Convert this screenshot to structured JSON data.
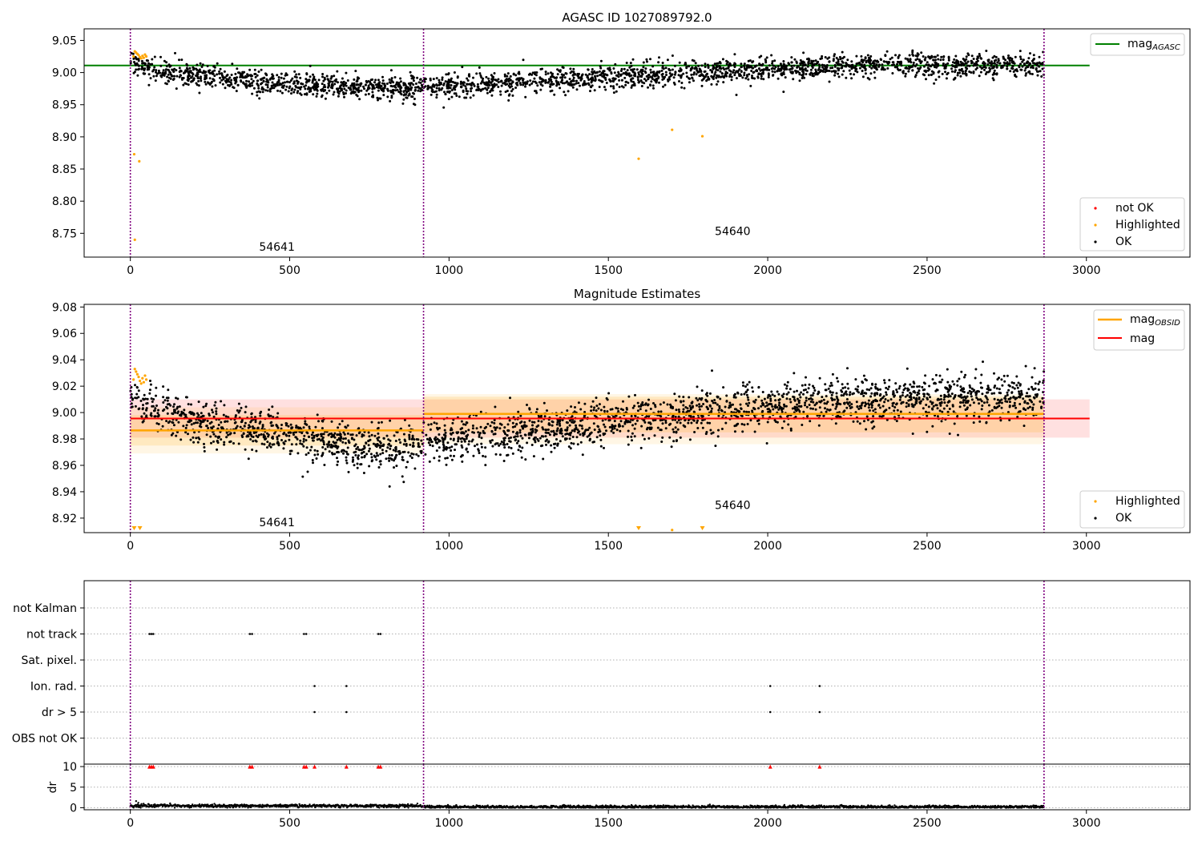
{
  "chart_data": [
    {
      "id": "agasc",
      "type": "scatter",
      "title": "AGASC ID 1027089792.0",
      "xlim": [
        -145,
        3325
      ],
      "ylim": [
        8.713,
        9.068
      ],
      "x_ticks": [
        0,
        500,
        1000,
        1500,
        2000,
        2500,
        3000
      ],
      "x_tick_labels": [
        "0",
        "500",
        "1000",
        "1500",
        "2000",
        "2500",
        "3000"
      ],
      "y_ticks": [
        8.75,
        8.8,
        8.85,
        8.9,
        8.95,
        9.0,
        9.05
      ],
      "y_tick_labels": [
        "8.75",
        "8.80",
        "8.85",
        "8.90",
        "8.95",
        "9.00",
        "9.05"
      ],
      "obsid_boundaries": [
        0,
        920,
        2867
      ],
      "obsid_labels": [
        {
          "text": "54641",
          "x": 460,
          "y": 8.723
        },
        {
          "text": "54640",
          "x": 1890,
          "y": 8.747
        }
      ],
      "mag_agasc": {
        "value": 9.011,
        "x_range": [
          -145,
          3010
        ],
        "color": "#008000"
      },
      "trend": {
        "x": [
          0,
          60,
          200,
          500,
          700,
          850,
          920,
          1200,
          1600,
          1900,
          2200,
          2500,
          2700,
          2867
        ],
        "y": [
          9.015,
          9.005,
          8.995,
          8.983,
          8.978,
          8.975,
          8.979,
          8.985,
          8.995,
          9.003,
          9.01,
          9.012,
          9.012,
          9.013
        ]
      },
      "noise": 0.009,
      "n_ok_points": 2600,
      "highlighted_points": {
        "x": [
          10,
          14,
          18,
          22,
          26,
          30,
          34,
          38,
          42,
          46,
          50,
          12,
          28,
          14,
          1595,
          1700,
          1795
        ],
        "y": [
          9.025,
          9.033,
          9.031,
          9.029,
          9.027,
          9.024,
          9.022,
          9.026,
          9.023,
          9.028,
          9.025,
          8.873,
          8.862,
          8.74,
          8.866,
          8.911,
          8.901
        ]
      },
      "legend_top": {
        "entries": [
          {
            "label": "mag",
            "subscript": "AGASC",
            "color": "#008000"
          }
        ],
        "placement": "top-right"
      },
      "legend_bottom": {
        "entries": [
          {
            "label": "not OK",
            "color": "#ff0000"
          },
          {
            "label": "Highlighted",
            "color": "#ffa500"
          },
          {
            "label": "OK",
            "color": "#000000"
          }
        ],
        "placement": "bottom-right"
      }
    },
    {
      "id": "estimates",
      "type": "scatter",
      "title": "Magnitude Estimates",
      "xlim": [
        -145,
        3325
      ],
      "ylim": [
        8.909,
        9.082
      ],
      "x_ticks": [
        0,
        500,
        1000,
        1500,
        2000,
        2500,
        3000
      ],
      "x_tick_labels": [
        "0",
        "500",
        "1000",
        "1500",
        "2000",
        "2500",
        "3000"
      ],
      "y_ticks": [
        8.92,
        8.94,
        8.96,
        8.98,
        9.0,
        9.02,
        9.04,
        9.06,
        9.08
      ],
      "y_tick_labels": [
        "8.92",
        "8.94",
        "8.96",
        "8.98",
        "9.00",
        "9.02",
        "9.04",
        "9.06",
        "9.08"
      ],
      "obsid_boundaries": [
        0,
        920,
        2867
      ],
      "obsid_labels": [
        {
          "text": "54641",
          "x": 460,
          "y": 8.914
        },
        {
          "text": "54640",
          "x": 1890,
          "y": 8.927
        }
      ],
      "mag": {
        "value": 8.9955,
        "band": [
          8.981,
          9.01
        ],
        "x_range": [
          0,
          3010
        ],
        "color": "#ff0000"
      },
      "mag_obsid": [
        {
          "x_range": [
            0,
            920
          ],
          "value": 8.9865,
          "band": [
            8.975,
            8.998
          ],
          "band_outer": [
            8.969,
            9.004
          ]
        },
        {
          "x_range": [
            920,
            2867
          ],
          "value": 8.999,
          "band": [
            8.985,
            9.012
          ],
          "band_outer": [
            8.976,
            9.014
          ]
        }
      ],
      "trend": {
        "x": [
          0,
          60,
          200,
          500,
          700,
          850,
          920,
          1200,
          1600,
          1900,
          2200,
          2500,
          2700,
          2867
        ],
        "y": [
          9.012,
          9.003,
          8.992,
          8.982,
          8.975,
          8.97,
          8.978,
          8.985,
          8.995,
          9.003,
          9.008,
          9.01,
          9.011,
          9.012
        ]
      },
      "noise": 0.0085,
      "n_ok_points": 2600,
      "highlighted_points": {
        "x": [
          10,
          14,
          18,
          22,
          26,
          30,
          34,
          38,
          42,
          46,
          50,
          1700
        ],
        "y": [
          9.025,
          9.033,
          9.031,
          9.029,
          9.027,
          9.024,
          9.022,
          9.026,
          9.023,
          9.028,
          9.025,
          8.911
        ]
      },
      "highlighted_offscale_x": [
        12,
        30,
        1595,
        1795
      ],
      "legend_top": {
        "entries": [
          {
            "label": "mag",
            "subscript": "OBSID",
            "color": "#ffa500"
          },
          {
            "label": "mag",
            "subscript": "",
            "color": "#ff0000"
          }
        ],
        "placement": "top-right"
      },
      "legend_bottom": {
        "entries": [
          {
            "label": "Highlighted",
            "color": "#ffa500"
          },
          {
            "label": "OK",
            "color": "#000000"
          }
        ],
        "placement": "bottom-right"
      }
    },
    {
      "id": "flags",
      "type": "scatter",
      "xlim": [
        -145,
        3325
      ],
      "categories": [
        "not Kalman",
        "not track",
        "Sat. pixel.",
        "Ion. rad.",
        "dr > 5",
        "OBS not OK"
      ],
      "obsid_boundaries": [
        0,
        920,
        2867
      ],
      "flag_points": [
        {
          "category": "not track",
          "x": [
            60,
            66,
            72,
            375,
            382,
            545,
            552,
            778,
            785
          ]
        },
        {
          "category": "Ion. rad.",
          "x": [
            578,
            678,
            2008,
            2163
          ]
        },
        {
          "category": "dr > 5",
          "x": [
            578,
            678,
            2008,
            2163
          ]
        }
      ]
    },
    {
      "id": "dr",
      "type": "scatter",
      "ylabel": "dr",
      "xlim": [
        -145,
        3325
      ],
      "ylim": [
        -0.5,
        10.6
      ],
      "x_ticks": [
        0,
        500,
        1000,
        1500,
        2000,
        2500,
        3000
      ],
      "x_tick_labels": [
        "0",
        "500",
        "1000",
        "1500",
        "2000",
        "2500",
        "3000"
      ],
      "y_ticks": [
        0,
        5,
        10
      ],
      "y_tick_labels": [
        "0",
        "5",
        "10"
      ],
      "obsid_boundaries": [
        0,
        920,
        2867
      ],
      "dr_level": [
        {
          "x_range": [
            0,
            920
          ],
          "value": 0.45
        },
        {
          "x_range": [
            920,
            2867
          ],
          "value": 0.2
        }
      ],
      "not_ok_markers_x": [
        60,
        66,
        72,
        375,
        382,
        545,
        552,
        578,
        678,
        778,
        785,
        2008,
        2163
      ],
      "not_ok_markers_y": 10
    }
  ]
}
